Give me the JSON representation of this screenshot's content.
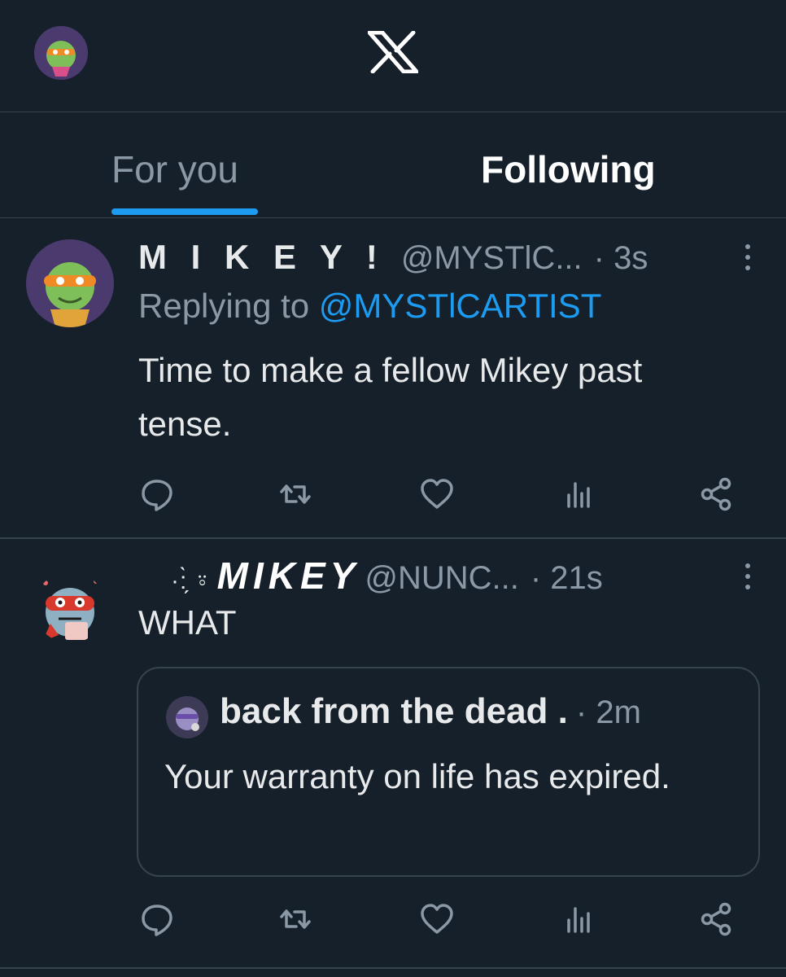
{
  "header": {
    "logo_icon": "x-logo-icon",
    "profile_avatar_icon": "profile-avatar"
  },
  "tabs": [
    {
      "label": "For you",
      "active": true
    },
    {
      "label": "Following",
      "active": false
    }
  ],
  "colors": {
    "background": "#15202b",
    "accent": "#1d9bf0",
    "muted_text": "#8b98a5",
    "primary_text": "#e7e9ea",
    "divider": "#38444d"
  },
  "tweets": [
    {
      "display_name": "M I K E Y !",
      "handle": "@MYSTlC...",
      "time": "· 3s",
      "reply_prefix": "Replying to",
      "reply_handle": "@MYSTlCARTIST",
      "text": "Time to make a fellow Mikey past tense.",
      "actions": [
        "reply-icon",
        "retweet-icon",
        "like-icon",
        "views-icon",
        "share-icon"
      ]
    },
    {
      "display_decoration": "·:̗̀ ⍤",
      "display_name": "MIKEY",
      "handle": "@NUNC...",
      "time": "· 21s",
      "text": "WHAT",
      "quote": {
        "display_name": "back from the dead .",
        "time": "· 2m",
        "text": "Your warranty on life has expired."
      },
      "actions": [
        "reply-icon",
        "retweet-icon",
        "like-icon",
        "views-icon",
        "share-icon"
      ]
    }
  ]
}
